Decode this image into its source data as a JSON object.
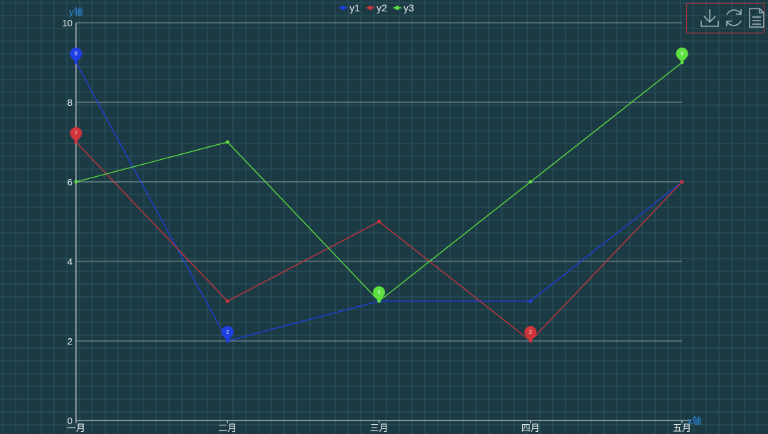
{
  "colors": {
    "background": "#1b3a44",
    "grid_minor": "#2c5560",
    "split_line": "#c8d2d6",
    "axis_line": "#e8eef0",
    "axis_name": "#2f8de4",
    "toolbox_border": "#d0343b"
  },
  "toolbox": {
    "icons": [
      "download-icon",
      "refresh-icon",
      "data-view-icon"
    ]
  },
  "chart_data": {
    "type": "line",
    "categories": [
      "一月",
      "二月",
      "三月",
      "四月",
      "五月"
    ],
    "series": [
      {
        "name": "y1",
        "color": "#1f3fe6",
        "values": [
          9,
          2,
          3,
          3,
          6
        ],
        "markers": [
          {
            "category": "一月",
            "value": 9,
            "label": "9"
          },
          {
            "category": "二月",
            "value": 2,
            "label": "2"
          }
        ]
      },
      {
        "name": "y2",
        "color": "#d0343b",
        "values": [
          7,
          3,
          5,
          2,
          6
        ],
        "markers": [
          {
            "category": "一月",
            "value": 7,
            "label": "7"
          },
          {
            "category": "四月",
            "value": 2,
            "label": "2"
          }
        ]
      },
      {
        "name": "y3",
        "color": "#5ee140",
        "values": [
          6,
          7,
          3,
          6,
          9
        ],
        "markers": [
          {
            "category": "三月",
            "value": 3,
            "label": "3"
          },
          {
            "category": "五月",
            "value": 9,
            "label": "9"
          }
        ]
      }
    ],
    "xlabel": "x轴",
    "ylabel": "y轴",
    "ylim": [
      0,
      10
    ],
    "yticks": [
      0,
      2,
      4,
      6,
      8,
      10
    ],
    "legend_position": "top-center",
    "grid": true
  }
}
